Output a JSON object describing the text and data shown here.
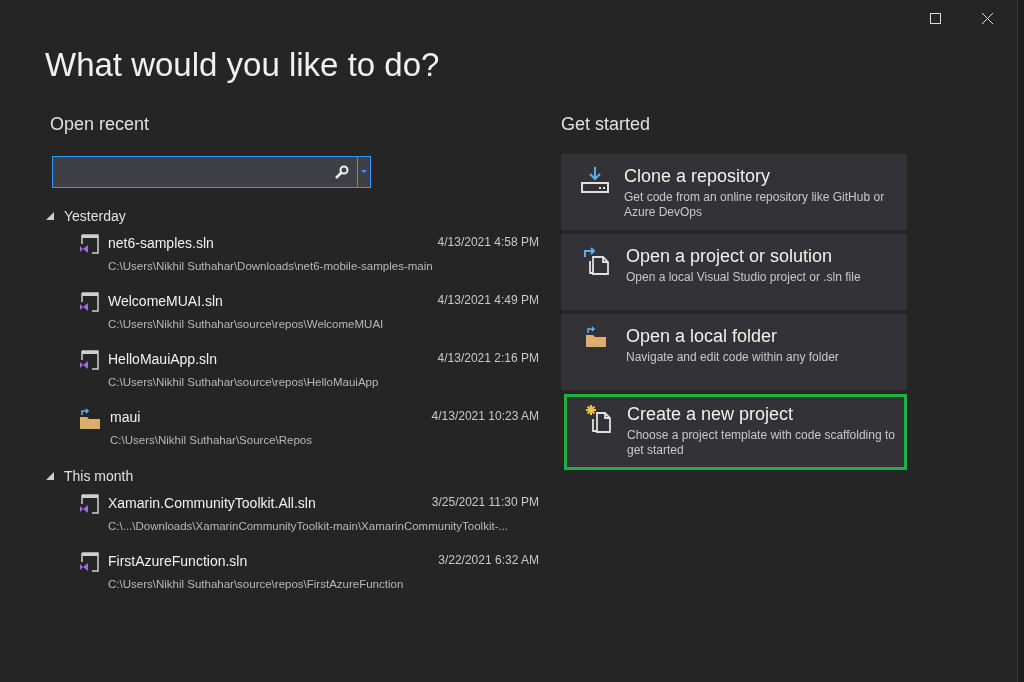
{
  "window": {
    "title": "What would you like to do?"
  },
  "open_recent": {
    "heading": "Open recent",
    "groups": [
      {
        "label": "Yesterday",
        "expanded": true,
        "items": [
          {
            "kind": "solution",
            "name": "net6-samples.sln",
            "path": "C:\\Users\\Nikhil Suthahar\\Downloads\\net6-mobile-samples-main",
            "date": "4/13/2021 4:58 PM"
          },
          {
            "kind": "solution",
            "name": "WelcomeMUAI.sln",
            "path": "C:\\Users\\Nikhil Suthahar\\source\\repos\\WelcomeMUAI",
            "date": "4/13/2021 4:49 PM"
          },
          {
            "kind": "solution",
            "name": "HelloMauiApp.sln",
            "path": "C:\\Users\\Nikhil Suthahar\\source\\repos\\HelloMauiApp",
            "date": "4/13/2021 2:16 PM"
          },
          {
            "kind": "folder",
            "name": "maui",
            "path": "C:\\Users\\Nikhil Suthahar\\Source\\Repos",
            "date": "4/13/2021 10:23 AM"
          }
        ]
      },
      {
        "label": "This month",
        "expanded": true,
        "items": [
          {
            "kind": "solution",
            "name": "Xamarin.CommunityToolkit.All.sln",
            "path": "C:\\...\\Downloads\\XamarinCommunityToolkit-main\\XamarinCommunityToolkit-...",
            "date": "3/25/2021 11:30 PM"
          },
          {
            "kind": "solution",
            "name": "FirstAzureFunction.sln",
            "path": "C:\\Users\\Nikhil Suthahar\\source\\repos\\FirstAzureFunction",
            "date": "3/22/2021 6:32 AM"
          }
        ]
      }
    ]
  },
  "get_started": {
    "heading": "Get started",
    "actions": [
      {
        "kind": "clone",
        "title": "Clone a repository",
        "description": "Get code from an online repository like GitHub or Azure DevOps",
        "highlighted": false
      },
      {
        "kind": "open-project",
        "title": "Open a project or solution",
        "description": "Open a local Visual Studio project or .sln file",
        "highlighted": false
      },
      {
        "kind": "open-folder",
        "title": "Open a local folder",
        "description": "Navigate and edit code within any folder",
        "highlighted": false
      },
      {
        "kind": "new-project",
        "title": "Create a new project",
        "description": "Choose a project template with code scaffolding to get started",
        "highlighted": true
      }
    ]
  }
}
